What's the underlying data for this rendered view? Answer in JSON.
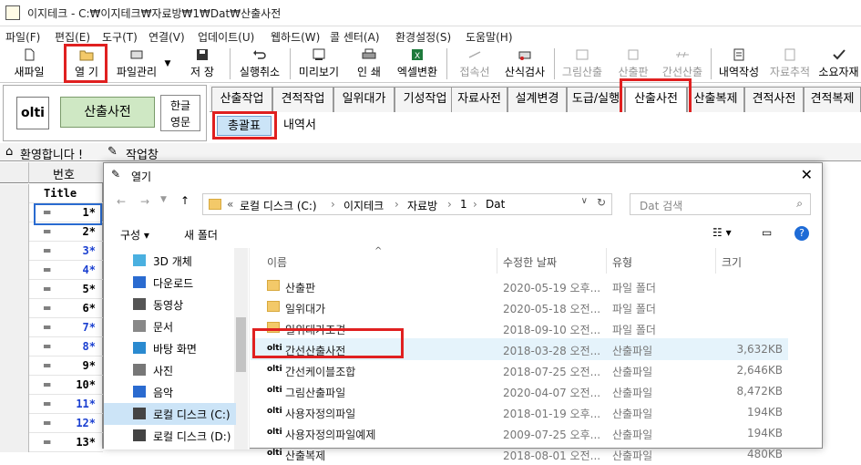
{
  "app": {
    "title": "이지테크 - C:₩이지테크₩자료방₩1₩Dat₩산출사전"
  },
  "menu": [
    "파일(F)",
    "편집(E)",
    "도구(T)",
    "연결(V)",
    "업데이트(U)",
    "웹하드(W)",
    "콜 센터(A)",
    "환경설정(S)",
    "도움말(H)"
  ],
  "toolbar": {
    "new": "새파일",
    "open": "열 기",
    "filemgr": "파일관리",
    "save": "저 장",
    "undo": "실행취소",
    "preview": "미리보기",
    "print": "인 쇄",
    "excel": "엑셀변환",
    "snap": "접속선",
    "check": "산식검사",
    "drawcalc": "그림산출",
    "calcplate": "산출판",
    "indirect": "간선산출",
    "detail": "내역작성",
    "trace": "자료추적",
    "small": "소요자재"
  },
  "left": {
    "logo": "olti",
    "dict": "산출사전",
    "lang1": "한글",
    "lang2": "영문"
  },
  "tabs": [
    "산출작업",
    "견적작업",
    "일위대가",
    "기성작업",
    "자료사전",
    "설계변경",
    "도급/실행",
    "산출사전",
    "산출복제",
    "견적사전",
    "견적복제"
  ],
  "subtabs": {
    "summary": "총괄표",
    "detail": "내역서"
  },
  "winbar": {
    "welcome": "환영합니다 !",
    "work": "작업창"
  },
  "grid": {
    "header": "번호",
    "title_row": "Title",
    "rows": [
      "1*",
      "2*",
      "3*",
      "4*",
      "5*",
      "6*",
      "7*",
      "8*",
      "9*",
      "10*",
      "11*",
      "12*",
      "13*"
    ]
  },
  "dialog": {
    "title": "열기",
    "path": [
      "로컬 디스크 (C:)",
      "이지테크",
      "자료방",
      "1",
      "Dat"
    ],
    "path_prefix": "«",
    "search_placeholder": "Dat 검색",
    "organize": "구성 ▾",
    "newfolder": "새 폴더",
    "columns": {
      "name": "이름",
      "date": "수정한 날짜",
      "type": "유형",
      "size": "크기"
    },
    "nav": [
      "3D 개체",
      "다운로드",
      "동영상",
      "문서",
      "바탕 화면",
      "사진",
      "음악",
      "로컬 디스크 (C:)",
      "로컬 디스크 (D:)"
    ],
    "files": [
      {
        "name": "산출판",
        "date": "2020-05-19 오후...",
        "type": "파일 폴더",
        "size": "",
        "kind": "folder"
      },
      {
        "name": "일위대가",
        "date": "2020-05-18 오전...",
        "type": "파일 폴더",
        "size": "",
        "kind": "folder"
      },
      {
        "name": "일위대가조견",
        "date": "2018-09-10 오전...",
        "type": "파일 폴더",
        "size": "",
        "kind": "folder"
      },
      {
        "name": "간선산출사전",
        "date": "2018-03-28 오전...",
        "type": "산출파일",
        "size": "3,632KB",
        "kind": "obj"
      },
      {
        "name": "간선케이블조합",
        "date": "2018-07-25 오전...",
        "type": "산출파일",
        "size": "2,646KB",
        "kind": "obj"
      },
      {
        "name": "그림산출파일",
        "date": "2020-04-07 오전...",
        "type": "산출파일",
        "size": "8,472KB",
        "kind": "obj"
      },
      {
        "name": "사용자정의파일",
        "date": "2018-01-19 오후...",
        "type": "산출파일",
        "size": "194KB",
        "kind": "obj"
      },
      {
        "name": "사용자정의파일예제",
        "date": "2009-07-25 오후...",
        "type": "산출파일",
        "size": "194KB",
        "kind": "obj"
      },
      {
        "name": "산출복제",
        "date": "2018-08-01 오전...",
        "type": "산출파일",
        "size": "480KB",
        "kind": "obj"
      }
    ]
  },
  "colors": {
    "highlight_red": "#e02020",
    "selected_blue": "#cce4f7",
    "green_button": "#cfe8c4"
  }
}
